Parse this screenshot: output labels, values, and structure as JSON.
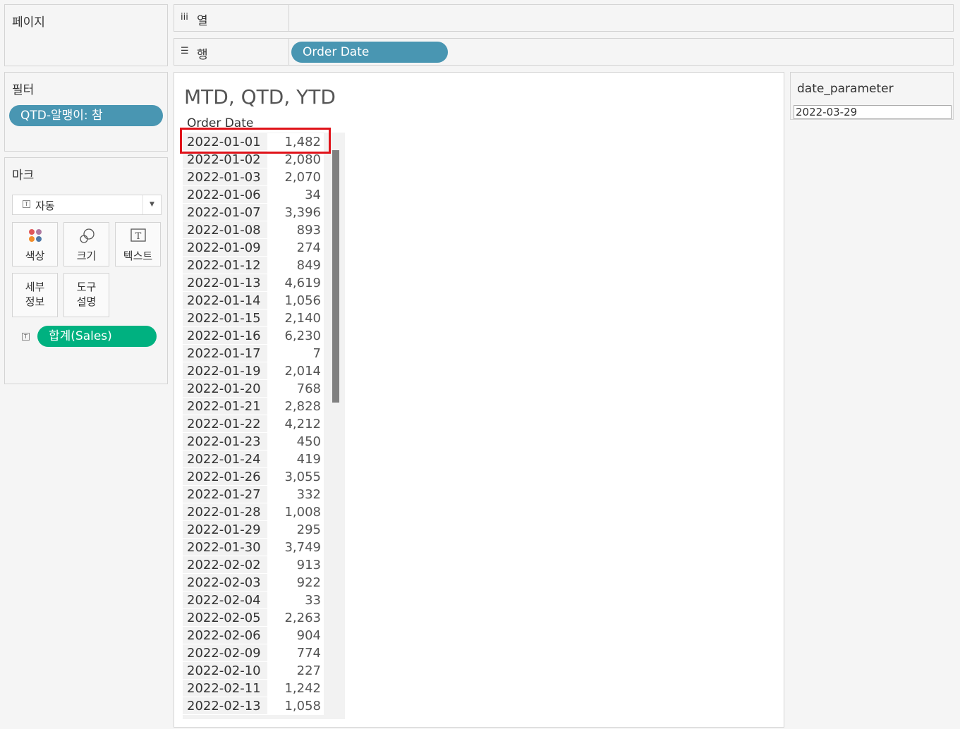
{
  "pages": {
    "title": "페이지"
  },
  "filters": {
    "title": "필터",
    "pills": [
      {
        "label": "QTD-알맹이: 참"
      }
    ]
  },
  "marks": {
    "title": "마크",
    "type_dropdown": {
      "value": "자동",
      "icon": "text-mark-icon"
    },
    "buttons": {
      "color": "색상",
      "size": "크기",
      "text": "텍스트",
      "detail": "세부\n정보",
      "tooltip": "도구\n설명"
    },
    "detail_label": "세부",
    "detail_label2": "정보",
    "tooltip_label": "도구",
    "tooltip_label2": "설명",
    "field_pill": {
      "label": "합계(Sales)",
      "icon": "text-mark-icon"
    }
  },
  "columns_shelf": {
    "label": "열",
    "icon": "columns-icon"
  },
  "rows_shelf": {
    "label": "행",
    "icon": "rows-icon",
    "pills": [
      {
        "label": "Order Date"
      }
    ]
  },
  "view": {
    "title": "MTD, QTD, YTD",
    "column_header": "Order Date",
    "rows": [
      {
        "date": "2022-01-01",
        "value": "1,482"
      },
      {
        "date": "2022-01-02",
        "value": "2,080"
      },
      {
        "date": "2022-01-03",
        "value": "2,070"
      },
      {
        "date": "2022-01-06",
        "value": "34"
      },
      {
        "date": "2022-01-07",
        "value": "3,396"
      },
      {
        "date": "2022-01-08",
        "value": "893"
      },
      {
        "date": "2022-01-09",
        "value": "274"
      },
      {
        "date": "2022-01-12",
        "value": "849"
      },
      {
        "date": "2022-01-13",
        "value": "4,619"
      },
      {
        "date": "2022-01-14",
        "value": "1,056"
      },
      {
        "date": "2022-01-15",
        "value": "2,140"
      },
      {
        "date": "2022-01-16",
        "value": "6,230"
      },
      {
        "date": "2022-01-17",
        "value": "7"
      },
      {
        "date": "2022-01-19",
        "value": "2,014"
      },
      {
        "date": "2022-01-20",
        "value": "768"
      },
      {
        "date": "2022-01-21",
        "value": "2,828"
      },
      {
        "date": "2022-01-22",
        "value": "4,212"
      },
      {
        "date": "2022-01-23",
        "value": "450"
      },
      {
        "date": "2022-01-24",
        "value": "419"
      },
      {
        "date": "2022-01-26",
        "value": "3,055"
      },
      {
        "date": "2022-01-27",
        "value": "332"
      },
      {
        "date": "2022-01-28",
        "value": "1,008"
      },
      {
        "date": "2022-01-29",
        "value": "295"
      },
      {
        "date": "2022-01-30",
        "value": "3,749"
      },
      {
        "date": "2022-02-02",
        "value": "913"
      },
      {
        "date": "2022-02-03",
        "value": "922"
      },
      {
        "date": "2022-02-04",
        "value": "33"
      },
      {
        "date": "2022-02-05",
        "value": "2,263"
      },
      {
        "date": "2022-02-06",
        "value": "904"
      },
      {
        "date": "2022-02-09",
        "value": "774"
      },
      {
        "date": "2022-02-10",
        "value": "227"
      },
      {
        "date": "2022-02-11",
        "value": "1,242"
      },
      {
        "date": "2022-02-13",
        "value": "1,058"
      }
    ]
  },
  "parameter": {
    "name": "date_parameter",
    "value": "2022-03-29"
  },
  "colors": {
    "blue_pill": "#4996b2",
    "green_pill": "#00b180",
    "highlight": "#e0131a"
  }
}
